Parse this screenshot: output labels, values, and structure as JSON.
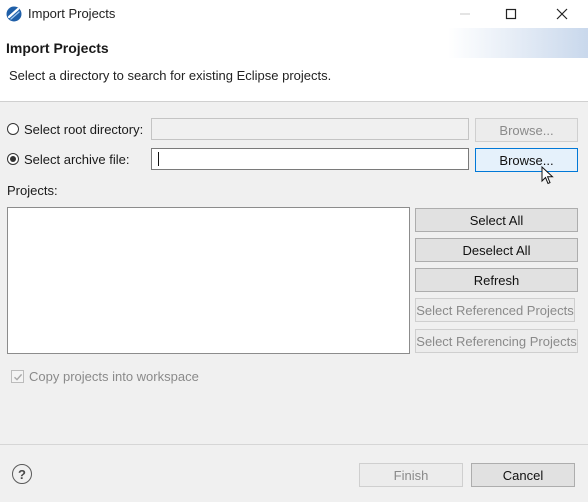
{
  "window": {
    "title": "Import Projects",
    "icon": "eclipse-icon",
    "controls": [
      "minimize-icon",
      "maximize-icon",
      "close-icon"
    ]
  },
  "header": {
    "title": "Import Projects",
    "description": "Select a directory to search for existing Eclipse projects."
  },
  "source": {
    "root_directory_label": "Select root directory:",
    "root_directory_value": "",
    "root_browse_label": "Browse...",
    "archive_file_label": "Select archive file:",
    "archive_file_value": "",
    "archive_browse_label": "Browse...",
    "selected_option": "archive"
  },
  "projects": {
    "label": "Projects:",
    "items": [],
    "buttons": {
      "select_all": "Select All",
      "deselect_all": "Deselect All",
      "refresh": "Refresh",
      "select_referenced": "Select Referenced Projects",
      "select_referencing": "Select Referencing Projects"
    }
  },
  "options": {
    "copy_into_workspace": "Copy projects into workspace",
    "copy_checked": true
  },
  "footer": {
    "finish": "Finish",
    "cancel": "Cancel",
    "help_symbol": "?"
  }
}
